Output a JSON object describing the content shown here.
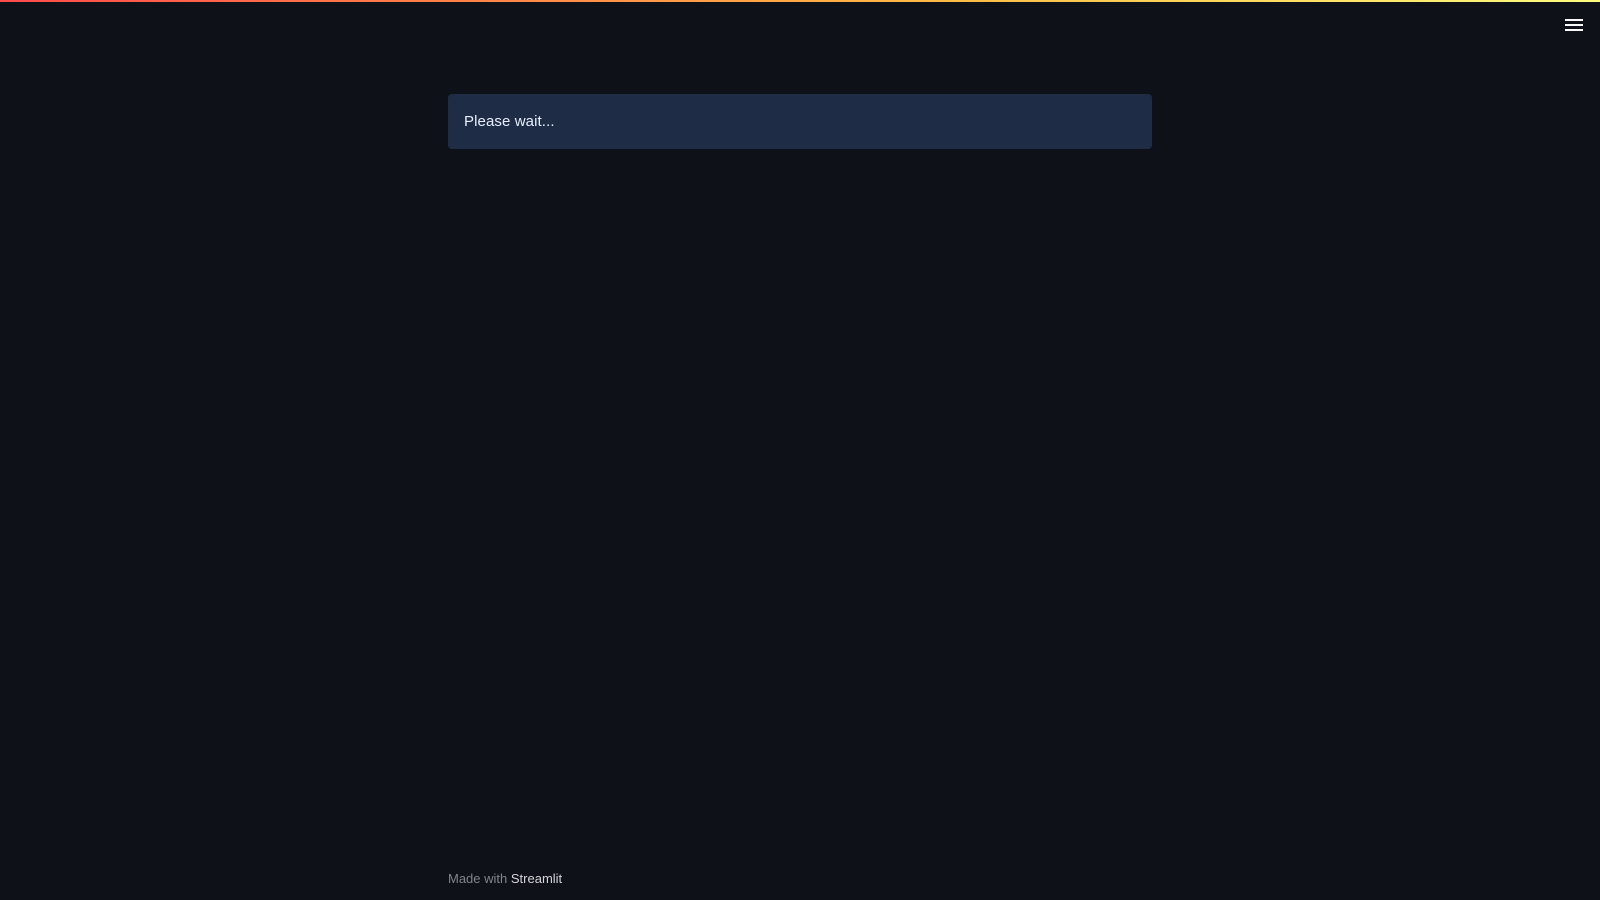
{
  "header": {
    "menu_icon": "hamburger-menu-icon",
    "gradient_colors": [
      "#ff4b4b",
      "#ffbd45",
      "#fffd80"
    ]
  },
  "main": {
    "alert": {
      "text": "Please wait..."
    }
  },
  "footer": {
    "prefix": "Made with",
    "link_label": "Streamlit"
  },
  "colors": {
    "background": "#0e1117",
    "alert_background": "#1e2c45",
    "alert_text": "#e8eefc"
  }
}
